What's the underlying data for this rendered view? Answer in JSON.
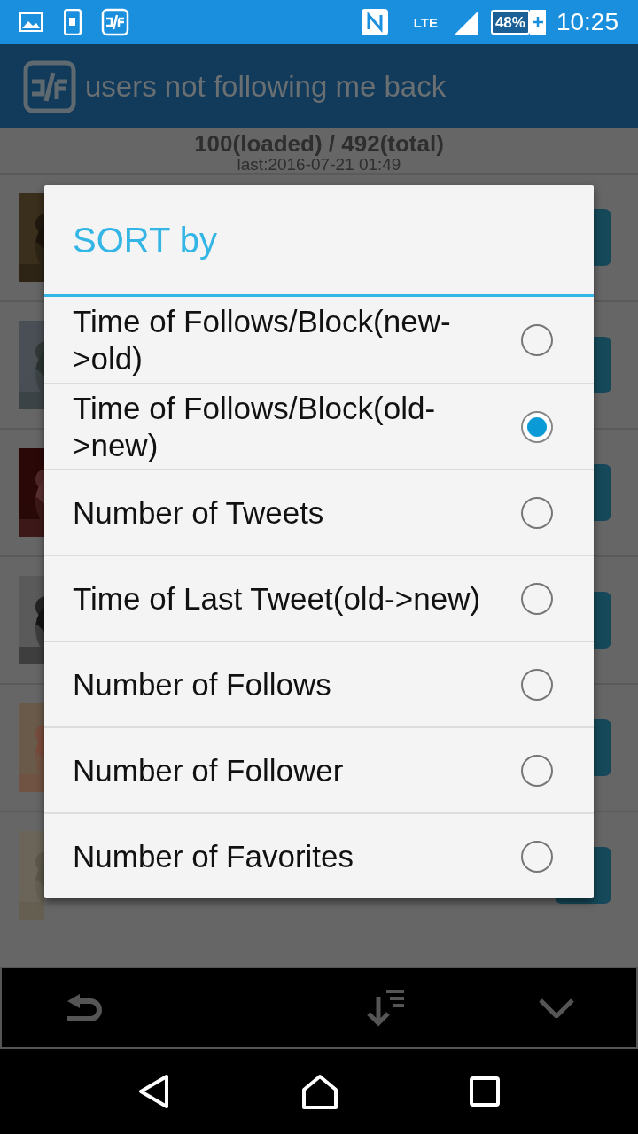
{
  "status_bar": {
    "network": "LTE",
    "battery": "48%",
    "time": "10:25"
  },
  "app_bar": {
    "title": "users not following me back"
  },
  "summary": {
    "counts": "100(loaded) / 492(total)",
    "last": "last:2016-07-21 01:49"
  },
  "dialog": {
    "title": "SORT by",
    "options": [
      {
        "label": "Time of Follows/Block(new->old)",
        "selected": false
      },
      {
        "label": "Time of Follows/Block(old->new)",
        "selected": true
      },
      {
        "label": "Number of Tweets",
        "selected": false
      },
      {
        "label": "Time of Last Tweet(old->new)",
        "selected": false
      },
      {
        "label": "Number of Follows",
        "selected": false
      },
      {
        "label": "Number of Follower",
        "selected": false
      },
      {
        "label": "Number of Favorites",
        "selected": false
      }
    ]
  }
}
